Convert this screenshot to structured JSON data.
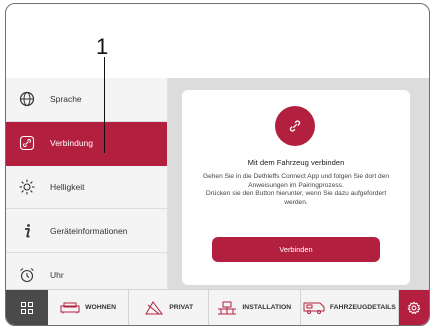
{
  "callout": {
    "number": "1"
  },
  "sidebar": {
    "items": [
      {
        "label": "Sprache",
        "icon": "globe-icon",
        "active": false
      },
      {
        "label": "Verbindung",
        "icon": "link-icon",
        "active": true
      },
      {
        "label": "Helligkeit",
        "icon": "sun-icon",
        "active": false
      },
      {
        "label": "Geräteinformationen",
        "icon": "info-icon",
        "active": false
      },
      {
        "label": "Uhr",
        "icon": "alarm-clock-icon",
        "active": false
      }
    ]
  },
  "main": {
    "card": {
      "icon": "link-icon",
      "title": "Mit dem Fahrzeug verbinden",
      "description_line1": "Gehen Sie in die Dethleffs Connect App und folgen Sie dort den",
      "description_line2": "Anweisungen im Pairingprozess.",
      "description_line3": "Drücken sie den Button hierunter, wenn Sie dazu aufgefordert",
      "description_line4": "werden.",
      "button_label": "Verbinden"
    }
  },
  "bottom_nav": {
    "items": [
      {
        "label": "WOHNEN",
        "icon": "sofa-icon"
      },
      {
        "label": "PRIVAT",
        "icon": "privacy-icon"
      },
      {
        "label": "INSTALLATION",
        "icon": "installation-icon"
      },
      {
        "label": "FAHRZEUGDETAILS",
        "icon": "vehicle-icon"
      }
    ]
  },
  "colors": {
    "accent": "#b3203f",
    "sidebar_bg": "#f4f4f4",
    "content_bg": "#dcdcdc",
    "grid_bg": "#4a4a4a"
  }
}
